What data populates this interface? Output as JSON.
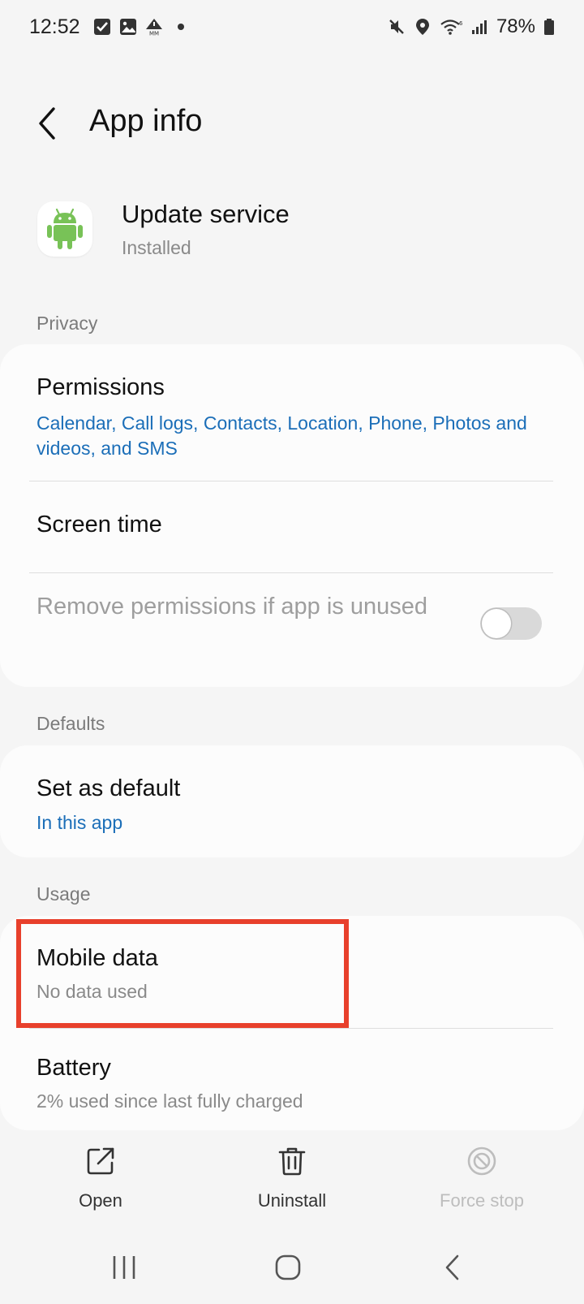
{
  "status_bar": {
    "time": "12:52",
    "battery": "78%",
    "left_icons": [
      "checkbox-icon",
      "image-icon",
      "mm-alert-icon",
      "dot-icon"
    ],
    "right_icons": [
      "mute-icon",
      "location-icon",
      "wifi-icon",
      "signal-icon",
      "battery-icon"
    ]
  },
  "header": {
    "title": "App info",
    "back_icon": "chevron-left-icon"
  },
  "app": {
    "name": "Update service",
    "status": "Installed",
    "icon": "android-icon",
    "accent": "#78c257"
  },
  "sections": {
    "privacy": {
      "label": "Privacy",
      "permissions": {
        "title": "Permissions",
        "subtitle": "Calendar, Call logs, Contacts, Location, Phone, Photos and videos, and SMS"
      },
      "screen_time": {
        "title": "Screen time"
      },
      "remove_permissions": {
        "title": "Remove permissions if app is unused",
        "enabled": false
      }
    },
    "defaults": {
      "label": "Defaults",
      "set_as_default": {
        "title": "Set as default",
        "subtitle": "In this app"
      }
    },
    "usage": {
      "label": "Usage",
      "mobile_data": {
        "title": "Mobile data",
        "subtitle": "No data used"
      },
      "battery": {
        "title": "Battery",
        "subtitle": "2% used since last fully charged"
      }
    }
  },
  "actions": {
    "open": {
      "label": "Open",
      "icon": "open-external-icon"
    },
    "uninstall": {
      "label": "Uninstall",
      "icon": "trash-icon"
    },
    "force_stop": {
      "label": "Force stop",
      "icon": "force-stop-icon",
      "enabled": false
    }
  },
  "nav": {
    "icons": [
      "recents-icon",
      "home-icon",
      "back-icon"
    ]
  },
  "colors": {
    "link": "#1b6eb8",
    "highlight": "#e8402c",
    "background": "#f5f5f5",
    "card": "#fcfcfc"
  }
}
